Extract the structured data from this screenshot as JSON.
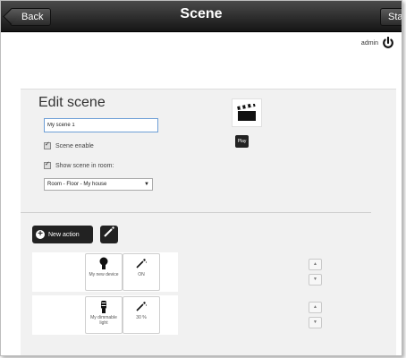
{
  "header": {
    "title": "Scene",
    "back_label": "Back",
    "start_label": "Start"
  },
  "user": {
    "name": "admin",
    "power_icon": "power-icon"
  },
  "edit": {
    "heading": "Edit scene",
    "scene_name": "My scene 1",
    "scene_enable_label": "Scene enable",
    "scene_enable_checked": true,
    "show_in_room_label": "Show scene in room:",
    "show_in_room_checked": true,
    "room_selected": "Room - Floor - My house",
    "scene_icon": "clapperboard-icon",
    "play_label": "Play"
  },
  "actions": {
    "new_action_label": "New action",
    "wand_icon": "wand-icon",
    "rows": [
      {
        "device_label": "My new device",
        "device_icon": "bulb-icon",
        "value_label": "ON",
        "value_icon": "wand-icon"
      },
      {
        "device_label": "My dimmable light",
        "device_icon": "dimmable-bulb-icon",
        "value_label": "30 %",
        "value_icon": "wand-icon"
      }
    ]
  },
  "colors": {
    "topbar": "#222222",
    "input_border": "#6e9fd6",
    "panel_bg": "#f1f1f1"
  }
}
